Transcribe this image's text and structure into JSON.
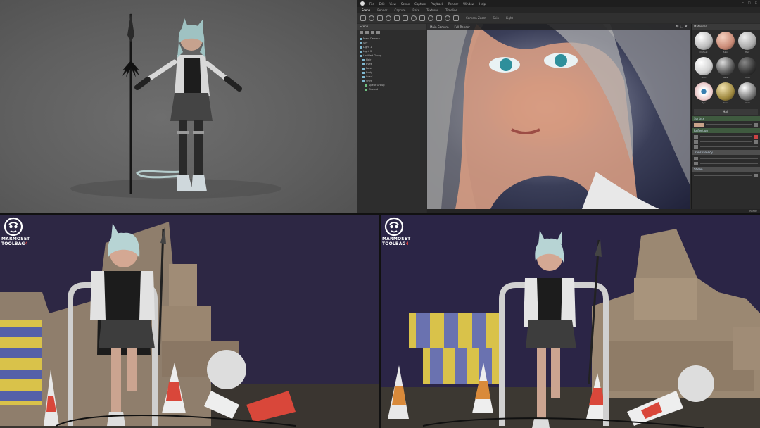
{
  "editor": {
    "menu": [
      "File",
      "Edit",
      "View",
      "Scene",
      "Capture",
      "Playback",
      "Render",
      "Window",
      "Help"
    ],
    "tabs": [
      "Scene",
      "Render",
      "Capture",
      "Bake",
      "Textures",
      "Timeline"
    ],
    "active_tab": "Scene",
    "toolbar_labels": [
      "Camera Zoom",
      "Skin",
      "Light"
    ],
    "scene_panel": {
      "title": "Scene",
      "items": [
        "Main Camera",
        "Sky",
        "Light 1",
        "Light 2",
        "Untitled Group",
        "Hair",
        "Eyes",
        "Face",
        "Body",
        "Scarf",
        "Shirt",
        "Spear Group",
        "Ground"
      ]
    },
    "viewport": {
      "tabs": [
        "Main Camera",
        "Full Render"
      ],
      "corner_label": "⚙ ⬚ ✕"
    },
    "status_right": "Ready",
    "material_panel": {
      "title": "Materials",
      "spheres": [
        "Default",
        "Skin",
        "Hair",
        "Shirt",
        "Metal",
        "Cloth",
        "Eye",
        "Brass",
        "Gloss"
      ],
      "selected_material": "Hair",
      "sections": [
        "Surface",
        "Reflection",
        "Transparency",
        "Sheen"
      ],
      "section_colors": {
        "normal": "#3f5a3f",
        "highlight": "#4f4f4f"
      }
    }
  },
  "renders": {
    "brand": {
      "line1": "MARMOSET",
      "line2": "TOOLBAG",
      "version": "4"
    }
  }
}
